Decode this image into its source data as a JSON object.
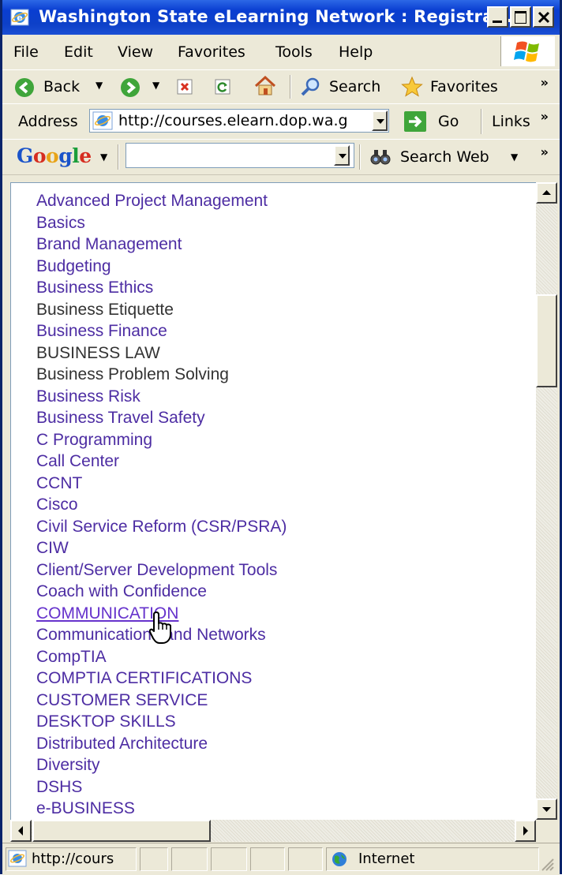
{
  "window": {
    "title": "Washington State eLearning Network : Registra..."
  },
  "menu": {
    "items": [
      "File",
      "Edit",
      "View",
      "Favorites",
      "Tools",
      "Help"
    ]
  },
  "toolbar": {
    "back_label": "Back",
    "search_label": "Search",
    "favorites_label": "Favorites"
  },
  "address": {
    "label": "Address",
    "url": "http://courses.elearn.dop.wa.g",
    "go_label": "Go",
    "links_label": "Links"
  },
  "google": {
    "logo": "Google",
    "search_web_label": "Search Web",
    "query": ""
  },
  "courses": [
    {
      "label": "Advanced Project Management",
      "style": "link"
    },
    {
      "label": "Basics",
      "style": "link"
    },
    {
      "label": "Brand Management",
      "style": "link"
    },
    {
      "label": "Budgeting",
      "style": "link"
    },
    {
      "label": "Business Ethics",
      "style": "link"
    },
    {
      "label": "Business Etiquette",
      "style": "plain"
    },
    {
      "label": "Business Finance",
      "style": "link"
    },
    {
      "label": "BUSINESS LAW",
      "style": "plain"
    },
    {
      "label": "Business Problem Solving",
      "style": "plain"
    },
    {
      "label": "Business Risk",
      "style": "link"
    },
    {
      "label": "Business Travel Safety",
      "style": "link"
    },
    {
      "label": "C Programming",
      "style": "link"
    },
    {
      "label": "Call Center",
      "style": "link"
    },
    {
      "label": "CCNT",
      "style": "link"
    },
    {
      "label": "Cisco",
      "style": "link"
    },
    {
      "label": "Civil Service Reform (CSR/PSRA)",
      "style": "link"
    },
    {
      "label": "CIW",
      "style": "link"
    },
    {
      "label": "Client/Server Development Tools",
      "style": "link"
    },
    {
      "label": "Coach with Confidence",
      "style": "link"
    },
    {
      "label": "COMMUNICATION",
      "style": "hover"
    },
    {
      "label": "Communications and Networks",
      "style": "link"
    },
    {
      "label": "CompTIA",
      "style": "link"
    },
    {
      "label": "COMPTIA CERTIFICATIONS",
      "style": "link"
    },
    {
      "label": "CUSTOMER SERVICE",
      "style": "link"
    },
    {
      "label": "DESKTOP SKILLS",
      "style": "link"
    },
    {
      "label": "Distributed Architecture",
      "style": "link"
    },
    {
      "label": "Diversity",
      "style": "link"
    },
    {
      "label": "DSHS",
      "style": "link"
    },
    {
      "label": "e-BUSINESS",
      "style": "link"
    }
  ],
  "status": {
    "url": "http://cours",
    "zone": "Internet"
  },
  "colors": {
    "link": "#4d2da3",
    "plain_text": "#333333",
    "title_bar": "#0a3ed1"
  }
}
